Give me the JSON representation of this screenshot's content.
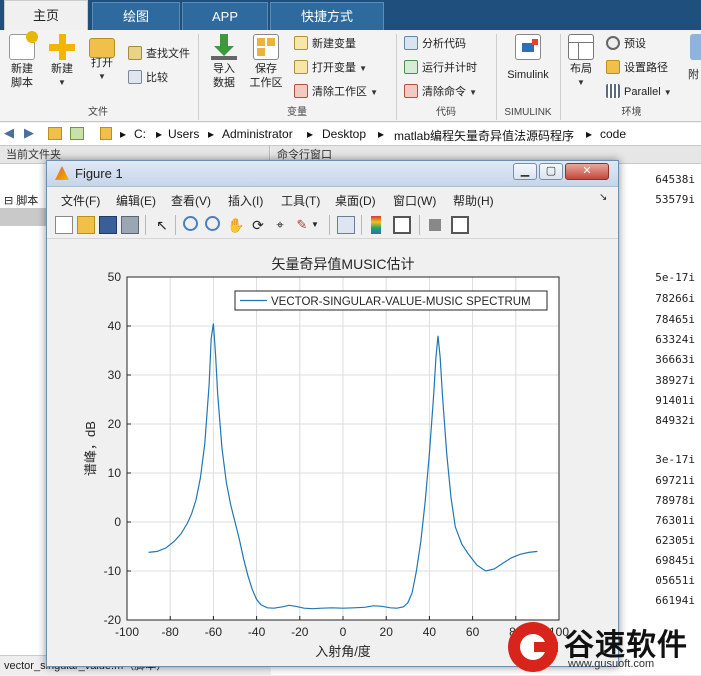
{
  "tabs": [
    "主页",
    "绘图",
    "APP",
    "快捷方式"
  ],
  "ribbon": {
    "new_script": "新建\n脚本",
    "new": "新建",
    "open": "打开",
    "find_files": "查找文件",
    "compare": "比较",
    "group_file": "文件",
    "import_data": "导入\n数据",
    "save_workspace": "保存\n工作区",
    "new_variable": "新建变量",
    "open_variable": "打开变量",
    "clear_workspace": "清除工作区",
    "group_variable": "变量",
    "analyze_code": "分析代码",
    "run_time": "运行并计时",
    "clear_commands": "清除命令",
    "group_code": "代码",
    "simulink": "Simulink",
    "group_simulink": "SIMULINK",
    "layout": "布局",
    "preferences": "预设",
    "set_path": "设置路径",
    "parallel": "Parallel",
    "addons": "附",
    "group_environment": "环境"
  },
  "address": {
    "parts": [
      "C:",
      "Users",
      "Administrator",
      "Desktop",
      "matlab编程矢量奇异值法源码程序",
      "code"
    ]
  },
  "panes": {
    "current_folder": "当前文件夹",
    "command_window": "命令行窗口",
    "script_label": "脚本",
    "status_bar": "vector_singular_value.m（脚本）"
  },
  "command_lines": [
    "64538i",
    "53579i",
    "5e-17i",
    "78266i",
    "78465i",
    "63324i",
    "36663i",
    "38927i",
    "91401i",
    "84932i",
    "3e-17i",
    "69721i",
    "78978i",
    "76301i",
    "62305i",
    "69845i",
    "05651i",
    "66194i"
  ],
  "figure": {
    "title": "Figure 1",
    "menu": [
      "文件(F)",
      "编辑(E)",
      "查看(V)",
      "插入(I)",
      "工具(T)",
      "桌面(D)",
      "窗口(W)",
      "帮助(H)"
    ]
  },
  "watermark": {
    "brand": "谷速软件",
    "url": "www.gusuoft.com"
  },
  "colors": {
    "line": "#1f77b4",
    "tab_bar": "#1e4f7d",
    "watermark_red": "#d9241c"
  },
  "chart_data": {
    "type": "line",
    "title": "矢量奇异值MUSIC估计",
    "xlabel": "入射角/度",
    "ylabel": "谱峰，dB",
    "xlim": [
      -100,
      100
    ],
    "ylim": [
      -20,
      50
    ],
    "xticks": [
      -100,
      -80,
      -60,
      -40,
      -20,
      0,
      20,
      40,
      60,
      80,
      100
    ],
    "yticks": [
      -20,
      -10,
      0,
      10,
      20,
      30,
      40,
      50
    ],
    "grid": true,
    "legend_position": "top-right",
    "series": [
      {
        "name": "VECTOR-SINGULAR-VALUE-MUSIC SPECTRUM",
        "x": [
          -90,
          -86,
          -82,
          -78,
          -75,
          -72,
          -70,
          -68,
          -66,
          -64,
          -62,
          -61,
          -60,
          -59,
          -58,
          -56,
          -54,
          -52,
          -50,
          -48,
          -46,
          -44,
          -42,
          -40,
          -38,
          -35,
          -32,
          -28,
          -25,
          -22,
          -18,
          -14,
          -10,
          -5,
          0,
          5,
          10,
          14,
          18,
          22,
          25,
          28,
          30,
          32,
          34,
          36,
          38,
          40,
          42,
          43,
          44,
          45,
          46,
          48,
          50,
          52,
          55,
          58,
          62,
          66,
          70,
          74,
          78,
          82,
          86,
          90
        ],
        "y": [
          -6.2,
          -6.0,
          -5.3,
          -3.9,
          -2.4,
          -0.2,
          1.8,
          4.6,
          9.0,
          16.0,
          28.0,
          37.5,
          40.5,
          34.0,
          26.0,
          15.0,
          8.0,
          3.5,
          0.0,
          -3.5,
          -7.5,
          -11.0,
          -13.8,
          -15.8,
          -16.9,
          -17.5,
          -17.6,
          -17.3,
          -17.0,
          -17.2,
          -17.6,
          -17.7,
          -17.6,
          -17.5,
          -17.6,
          -17.5,
          -17.4,
          -17.1,
          -17.2,
          -17.5,
          -17.6,
          -17.3,
          -16.5,
          -14.5,
          -10.0,
          -4.0,
          4.0,
          14.0,
          26.0,
          33.5,
          38.0,
          33.5,
          26.0,
          14.0,
          5.0,
          -1.0,
          -4.5,
          -6.5,
          -8.8,
          -10.0,
          -9.6,
          -8.4,
          -7.3,
          -6.6,
          -6.2,
          -6.0
        ]
      }
    ]
  }
}
